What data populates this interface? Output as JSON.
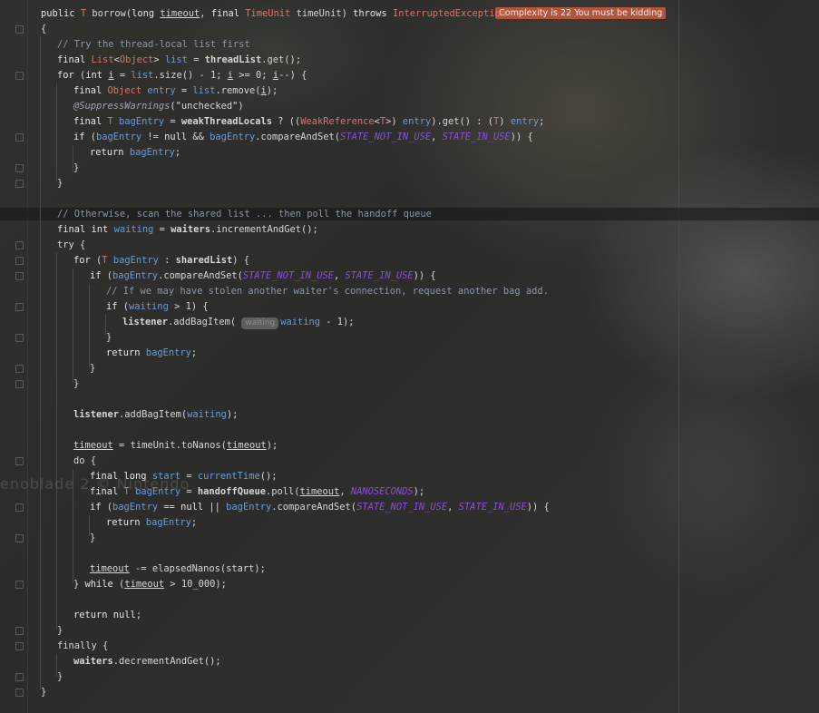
{
  "editor": {
    "complexity_hint": "Complexity is 22 You must be kidding",
    "inlay_hint_param": "waiting",
    "watermark": "enoblade 2 © Nintendo"
  },
  "code_lines": [
    "public T borrow(long timeout, final TimeUnit timeUnit) throws InterruptedException",
    "{",
    "// Try the thread-local list first",
    "final List<Object> list = threadList.get();",
    "for (int i = list.size() - 1; i >= 0; i--) {",
    "final Object entry = list.remove(i);",
    "@SuppressWarnings(\"unchecked\")",
    "final T bagEntry = weakThreadLocals ? ((WeakReference<T>) entry).get() : (T) entry;",
    "if (bagEntry != null && bagEntry.compareAndSet(STATE_NOT_IN_USE, STATE_IN_USE)) {",
    "return bagEntry;",
    "}",
    "}",
    "",
    "// Otherwise, scan the shared list ... then poll the handoff queue",
    "final int waiting = waiters.incrementAndGet();",
    "try {",
    "for (T bagEntry : sharedList) {",
    "if (bagEntry.compareAndSet(STATE_NOT_IN_USE, STATE_IN_USE)) {",
    "// If we may have stolen another waiter's connection, request another bag add.",
    "if (waiting > 1) {",
    "listener.addBagItem(waiting waiting - 1);",
    "}",
    "return bagEntry;",
    "}",
    "}",
    "",
    "listener.addBagItem(waiting);",
    "",
    "timeout = timeUnit.toNanos(timeout);",
    "do {",
    "final long start = currentTime();",
    "final T bagEntry = handoffQueue.poll(timeout, NANOSECONDS);",
    "if (bagEntry == null || bagEntry.compareAndSet(STATE_NOT_IN_USE, STATE_IN_USE)) {",
    "return bagEntry;",
    "}",
    "",
    "timeout -= elapsedNanos(start);",
    "} while (timeout > 10_000);",
    "",
    "return null;",
    "}",
    "finally {",
    "waiters.decrementAndGet();",
    "}",
    "}"
  ]
}
